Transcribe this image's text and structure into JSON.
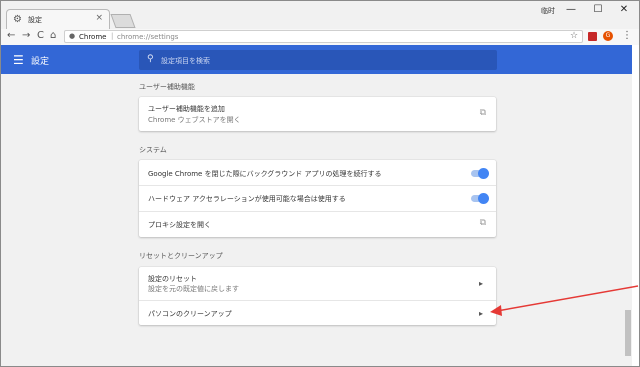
{
  "window": {
    "tab_title": "設定",
    "tab_icon": "gear-icon",
    "tab_close": "×",
    "user_label": "临时",
    "controls": {
      "minimize": "—",
      "maximize": "☐",
      "close": "✕"
    }
  },
  "toolbar": {
    "back": "←",
    "forward": "→",
    "reload": "C",
    "home": "⌂",
    "scheme": "Chrome",
    "separator": "|",
    "url": "chrome://settings",
    "bookmark_star": "☆",
    "ext2_label": "G",
    "menu": "⋮"
  },
  "header": {
    "menu_icon": "☰",
    "title": "設定",
    "search_icon": "🔍",
    "search_placeholder": "設定項目を検索"
  },
  "sections": {
    "accessibility": {
      "title": "ユーザー補助機能",
      "add_title": "ユーザー補助機能を追加",
      "add_sub": "Chrome ウェブストアを開く",
      "external_icon": "⧉"
    },
    "system": {
      "title": "システム",
      "background_apps": "Google Chrome を閉じた際にバックグラウンド アプリの処理を続行する",
      "background_apps_on": true,
      "hardware_accel": "ハードウェア アクセラレーションが使用可能な場合は使用する",
      "hardware_accel_on": true,
      "proxy": "プロキシ設定を開く",
      "external_icon": "⧉"
    },
    "reset": {
      "title": "リセットとクリーンアップ",
      "reset_title": "設定のリセット",
      "reset_sub": "設定を元の既定値に戻します",
      "cleanup": "パソコンのクリーンアップ",
      "chevron": "▸"
    }
  },
  "colors": {
    "header_blue": "#3367d6",
    "search_blue": "#2956b8",
    "toggle_blue": "#4285f4",
    "arrow_red": "#e53935"
  }
}
